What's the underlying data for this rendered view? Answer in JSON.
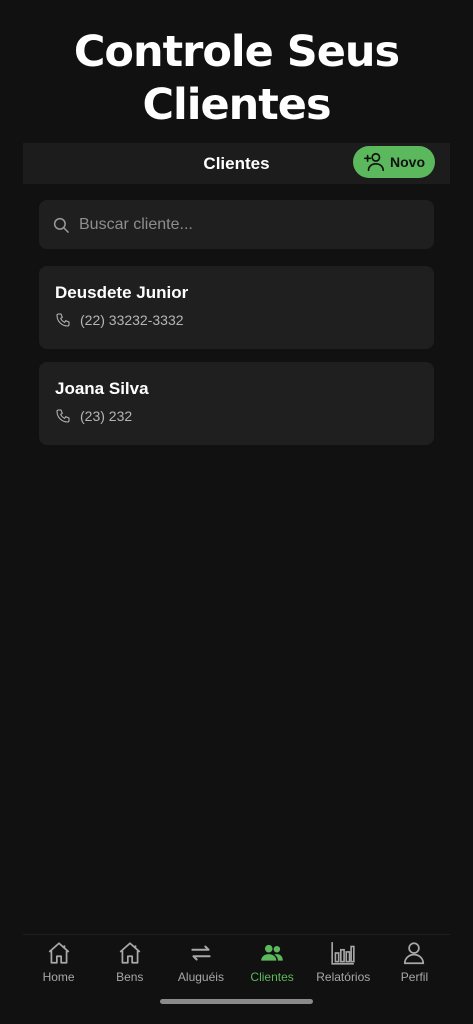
{
  "hero": {
    "title_line1": "Controle Seus",
    "title_line2": "Clientes"
  },
  "header": {
    "title": "Clientes",
    "new_button_label": "Novo"
  },
  "search": {
    "placeholder": "Buscar cliente..."
  },
  "clients": [
    {
      "name": "Deusdete Junior",
      "phone": "(22) 33232-3332"
    },
    {
      "name": "Joana Silva",
      "phone": "(23) 232"
    }
  ],
  "tabs": [
    {
      "label": "Home",
      "icon": "home-icon"
    },
    {
      "label": "Bens",
      "icon": "home-icon"
    },
    {
      "label": "Aluguéis",
      "icon": "swap-arrows-icon"
    },
    {
      "label": "Clientes",
      "icon": "users-icon",
      "active": true
    },
    {
      "label": "Relatórios",
      "icon": "bar-chart-icon"
    },
    {
      "label": "Perfil",
      "icon": "person-icon"
    }
  ],
  "colors": {
    "accent": "#5cb85c",
    "background": "#111111",
    "card": "#1f1f1f"
  }
}
